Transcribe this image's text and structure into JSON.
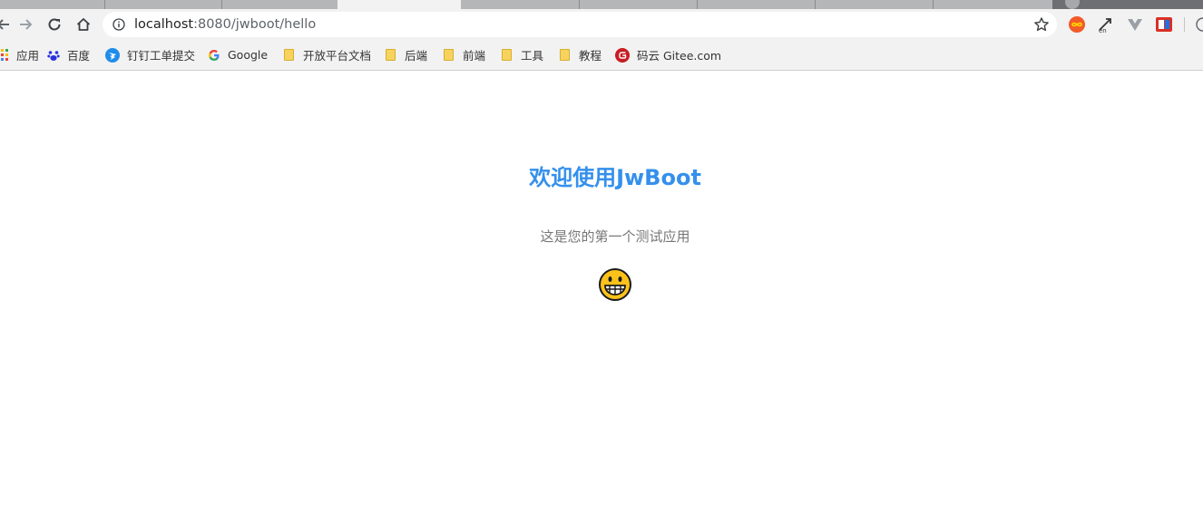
{
  "browser": {
    "address": {
      "host": "localhost",
      "rest": ":8080/jwboot/hello"
    },
    "bookmarks": [
      {
        "label": "应用",
        "icon": "apps-icon"
      },
      {
        "label": "百度",
        "icon": "baidu-icon"
      },
      {
        "label": "钉钉工单提交",
        "icon": "dingtalk-icon"
      },
      {
        "label": "Google",
        "icon": "google-icon"
      },
      {
        "label": "开放平台文档",
        "icon": "folder-icon"
      },
      {
        "label": "后端",
        "icon": "folder-icon"
      },
      {
        "label": "前端",
        "icon": "folder-icon"
      },
      {
        "label": "工具",
        "icon": "folder-icon"
      },
      {
        "label": "教程",
        "icon": "folder-icon"
      },
      {
        "label": "码云 Gitee.com",
        "icon": "gitee-icon"
      }
    ],
    "extensions": [
      "infinity-icon",
      "translate-icon",
      "vue-devtools-icon",
      "fe-helper-icon"
    ],
    "colors": {
      "accent": "#3590ec",
      "bar": "#f2f2f3"
    }
  },
  "page": {
    "title": "欢迎使用JwBoot",
    "subtitle": "这是您的第一个测试应用",
    "emoji": "grinning-face-icon"
  }
}
